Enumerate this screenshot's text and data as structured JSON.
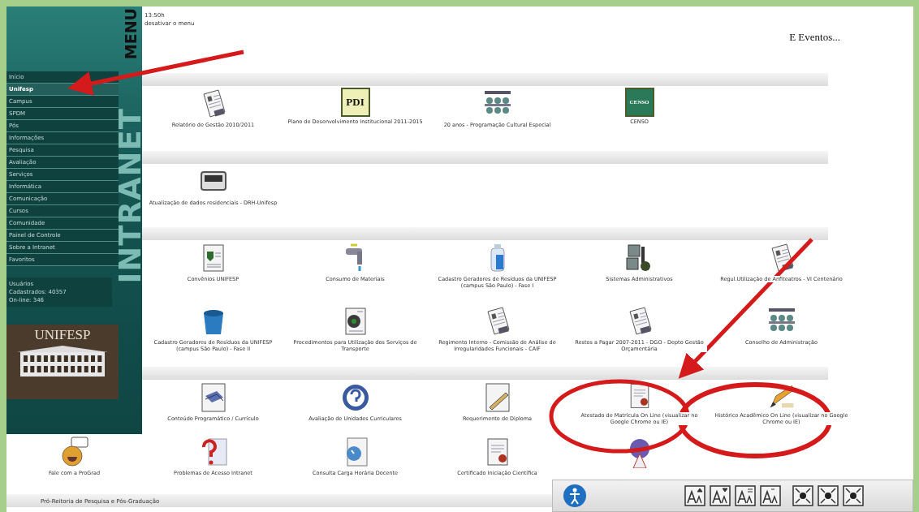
{
  "sidebar": {
    "menu_label": "MENU",
    "brand": "INTRANET",
    "items": [
      {
        "label": "Início",
        "selected": false
      },
      {
        "label": "Unifesp",
        "selected": true
      },
      {
        "label": "Campus",
        "selected": false
      },
      {
        "label": "SPDM",
        "selected": false
      },
      {
        "label": "Pós",
        "selected": false
      },
      {
        "label": "Informações",
        "selected": false
      },
      {
        "label": "Pesquisa",
        "selected": false
      },
      {
        "label": "Avaliação",
        "selected": false
      },
      {
        "label": "Serviços",
        "selected": false
      },
      {
        "label": "Informática",
        "selected": false
      },
      {
        "label": "Comunicação",
        "selected": false
      },
      {
        "label": "Cursos",
        "selected": false
      },
      {
        "label": "Comunidade",
        "selected": false
      },
      {
        "label": "Painel de Controle",
        "selected": false
      },
      {
        "label": "Sobre a Intranet",
        "selected": false
      },
      {
        "label": "Favoritos",
        "selected": false
      }
    ],
    "stats": [
      "Usuários",
      "Cadastrados: 40357",
      "On-line: 346"
    ],
    "logo_text": "UNIFESP"
  },
  "header": {
    "time": "13:50h",
    "menu_toggle": "desativar o menu",
    "events": "E Eventos..."
  },
  "sections": [
    {
      "items": [
        {
          "label": "Relatório de Gestão 2010/2011"
        },
        {
          "label": "Plano de Desenvolvimento Institucional 2011-2015",
          "badge": "PDI"
        },
        {
          "label": "20 anos - Programação Cultural Especial"
        },
        {
          "label": "CENSO",
          "badge": "CENSO"
        }
      ]
    },
    {
      "items": [
        {
          "label": "Atualização de dados residenciais - DRH-Unifesp"
        }
      ]
    },
    {
      "items": [
        {
          "label": "Convênios UNIFESP"
        },
        {
          "label": "Consumo de Materiais"
        },
        {
          "label": "Cadastro Geradores de Resíduos da UNIFESP (campus São Paulo) - Fase I"
        },
        {
          "label": "Sistemas Administrativos"
        },
        {
          "label": "Regul.Utilização de Anfiteatros - VI Centenário"
        },
        {
          "label": "Cadastro Geradores de Resíduos da UNIFESP (campus São Paulo) - Fase II"
        },
        {
          "label": "Procedimentos para Utilização dos Serviços de Transporte"
        },
        {
          "label": "Regimento Interno - Comissão de Análise de Irregularidades Funcionais - CAIF"
        },
        {
          "label": "Restos a Pagar 2007-2011 - DGO - Depto Gestão Orçamentária"
        },
        {
          "label": "Conselho de Administração"
        }
      ]
    },
    {
      "items": [
        {
          "label": "Conteúdo Programático / Currículo"
        },
        {
          "label": "Avaliação de Unidades Curriculares"
        },
        {
          "label": "Requerimento de Diploma"
        },
        {
          "label": "Atestado de Matrícula On Line (visualizar no Google Chrome ou IE)"
        },
        {
          "label": "Histórico Acadêmico On Line (visualizar no Google Chrome ou IE)"
        }
      ],
      "lower_items": [
        {
          "label": "Fale com a ProGrad"
        },
        {
          "label": "Problemas de Acesso Intranet"
        },
        {
          "label": "Consulta Carga Horária Docente"
        },
        {
          "label": "Certificado Iniciação Científica"
        }
      ]
    }
  ],
  "footer_bar": "Pró-Reitoria de Pesquisa e Pós-Graduação"
}
